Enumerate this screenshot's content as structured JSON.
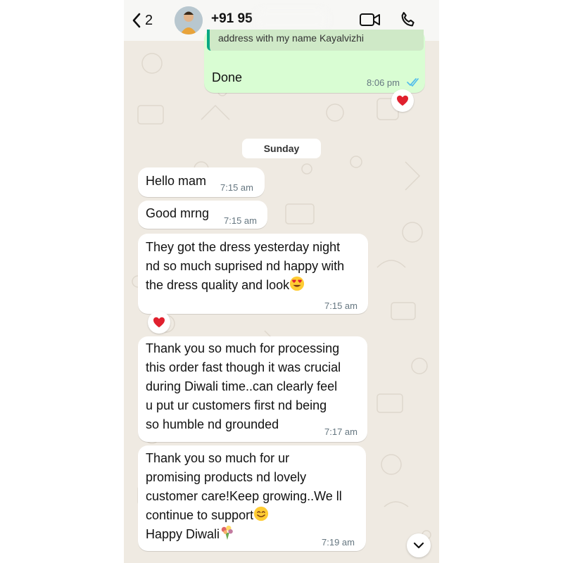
{
  "header": {
    "back_count": "2",
    "contact_name": "+91 95",
    "icons": [
      "chevron-left-icon",
      "video-call-icon",
      "phone-icon"
    ]
  },
  "colors": {
    "wallpaper": "#efeae2",
    "incoming_bubble": "#ffffff",
    "outgoing_bubble": "#d9fdd3",
    "read_ticks": "#53bdeb",
    "quote_bar": "#06a884"
  },
  "chat": {
    "outgoing": {
      "quoted_text": "address with my name Kayalvizhi",
      "text": "Done",
      "time": "8:06 pm",
      "status": "read",
      "reaction": "heart"
    },
    "day_separator": "Sunday",
    "messages": [
      {
        "text": "Hello mam",
        "time": "7:15 am"
      },
      {
        "text": "Good mrng",
        "time": "7:15 am"
      },
      {
        "line1": "They got the dress yesterday night",
        "line2": "nd so much suprised nd happy with",
        "line3": "the dress quality and look",
        "emoji": "heart-eyes",
        "time": "7:15 am",
        "reaction": "heart"
      },
      {
        "text": "Thank you so much for processing\nthis order fast though it was crucial\nduring Diwali time..can clearly feel\nu put ur customers first nd being\nso humble nd grounded",
        "time": "7:17 am"
      },
      {
        "line1": "Thank you so much for ur",
        "line2": "promising products nd lovely",
        "line3": "customer care!Keep growing..We ll",
        "line4": "continue to support",
        "line5": "Happy Diwali",
        "emoji4": "smile",
        "emoji5": "bouquet",
        "time": "7:19 am"
      }
    ]
  }
}
